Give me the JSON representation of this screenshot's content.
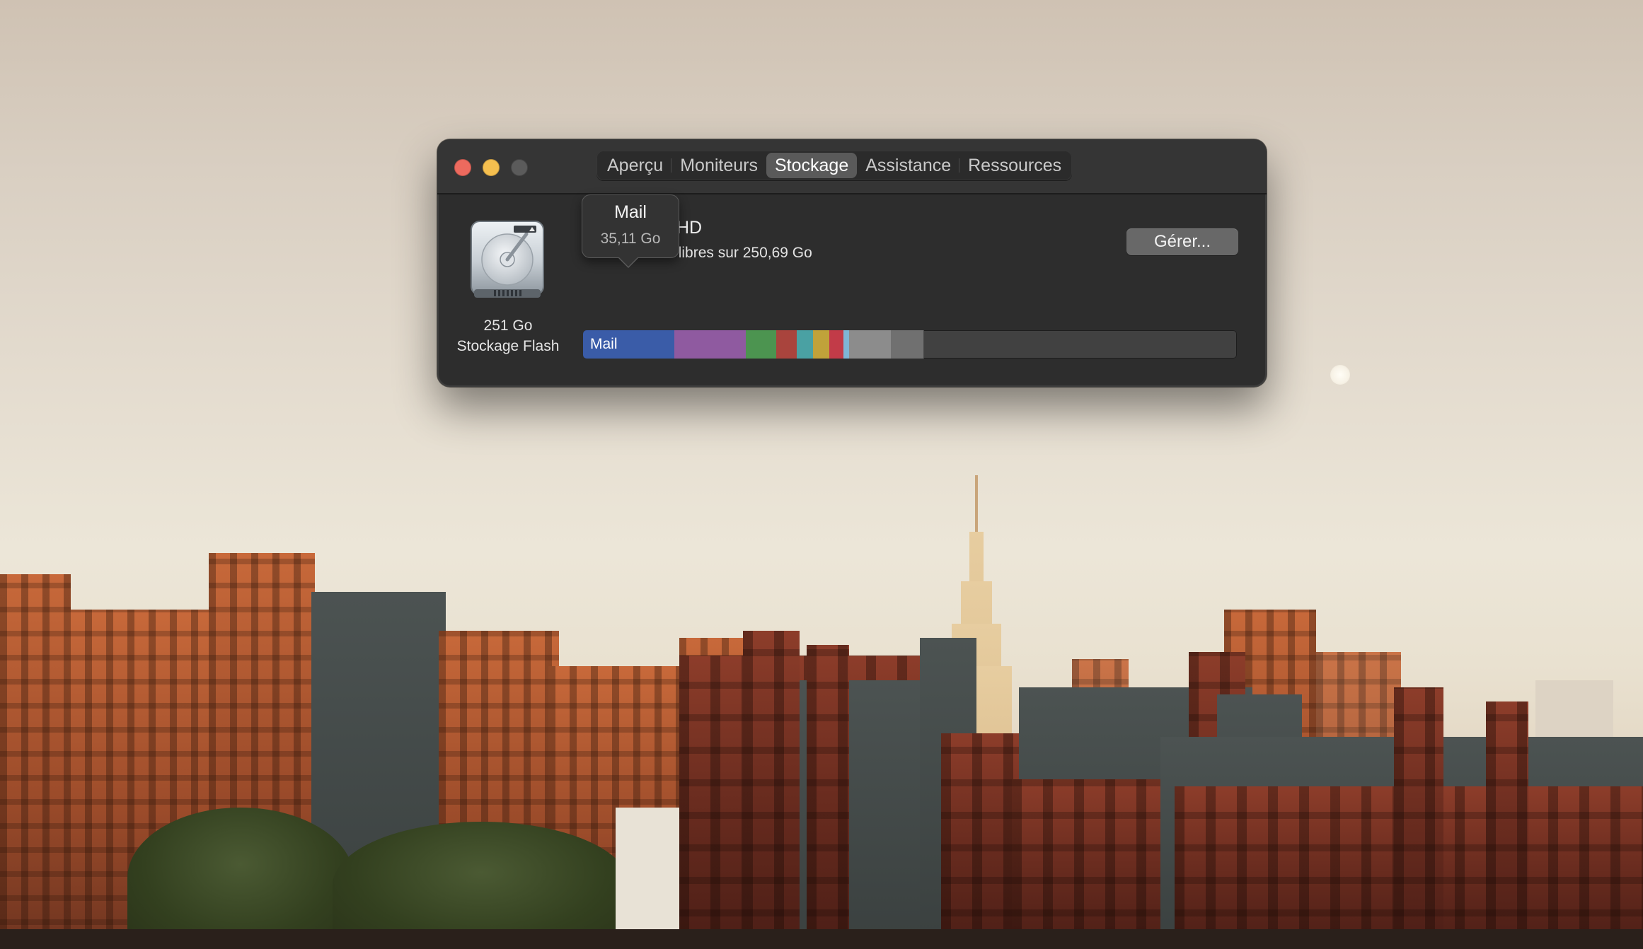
{
  "window": {
    "tabs": [
      {
        "label": "Aperçu",
        "selected": false
      },
      {
        "label": "Moniteurs",
        "selected": false
      },
      {
        "label": "Stockage",
        "selected": true
      },
      {
        "label": "Assistance",
        "selected": false
      },
      {
        "label": "Ressources",
        "selected": false
      }
    ]
  },
  "disk": {
    "icon": "hard-drive-icon",
    "capacity": "251 Go",
    "type": "Stockage Flash"
  },
  "volume": {
    "name_visible": "HD",
    "free_space_visible": "o de libres sur 250,69 Go"
  },
  "manage_button": {
    "label": "Gérer..."
  },
  "storage_bar": {
    "total_gb": 250.69,
    "segments": [
      {
        "key": "mail",
        "label": "Mail",
        "color": "#3a5ca8",
        "gb": 35.11
      },
      {
        "key": "purple",
        "label": "",
        "color": "#8f5aa0",
        "gb": 27.3
      },
      {
        "key": "green",
        "label": "",
        "color": "#4c9450",
        "gb": 11.7
      },
      {
        "key": "red",
        "label": "",
        "color": "#a9443d",
        "gb": 7.8
      },
      {
        "key": "teal",
        "label": "",
        "color": "#4aa1a3",
        "gb": 6.2
      },
      {
        "key": "yellow",
        "label": "",
        "color": "#c0a23a",
        "gb": 6.2
      },
      {
        "key": "crimson",
        "label": "",
        "color": "#c23b48",
        "gb": 5.5
      },
      {
        "key": "lightblue",
        "label": "",
        "color": "#7fb6d6",
        "gb": 2.3
      },
      {
        "key": "other-light",
        "label": "",
        "color": "#8c8c8c",
        "gb": 16.0
      },
      {
        "key": "other-dark",
        "label": "",
        "color": "#707070",
        "gb": 12.5
      }
    ]
  },
  "tooltip": {
    "title": "Mail",
    "value": "35,11 Go"
  }
}
